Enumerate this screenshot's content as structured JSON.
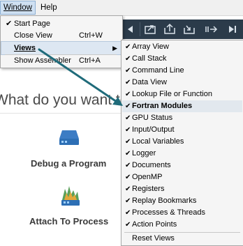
{
  "menubar": {
    "window_label": "Window",
    "help_label": "Help"
  },
  "window_menu": {
    "items": [
      {
        "label": "Start Page",
        "checked": true,
        "shortcut": ""
      },
      {
        "label": "Close View",
        "checked": false,
        "shortcut": "Ctrl+W"
      },
      {
        "label": "Views",
        "checked": false,
        "shortcut": "",
        "submenu": true
      },
      {
        "label": "Show Assembler",
        "checked": false,
        "shortcut": "Ctrl+A"
      }
    ]
  },
  "views_menu": {
    "items": [
      {
        "label": "Array View",
        "checked": true
      },
      {
        "label": "Call Stack",
        "checked": true
      },
      {
        "label": "Command Line",
        "checked": true
      },
      {
        "label": "Data View",
        "checked": true
      },
      {
        "label": "Lookup File or Function",
        "checked": true
      },
      {
        "label": "Fortran Modules",
        "checked": true
      },
      {
        "label": "GPU Status",
        "checked": true
      },
      {
        "label": "Input/Output",
        "checked": true
      },
      {
        "label": "Local Variables",
        "checked": true
      },
      {
        "label": "Logger",
        "checked": true
      },
      {
        "label": "Documents",
        "checked": true
      },
      {
        "label": "OpenMP",
        "checked": true
      },
      {
        "label": "Registers",
        "checked": true
      },
      {
        "label": "Replay Bookmarks",
        "checked": true
      },
      {
        "label": "Processes & Threads",
        "checked": true
      },
      {
        "label": "Action Points",
        "checked": true
      }
    ],
    "reset_label": "Reset Views"
  },
  "start_page": {
    "heading": "What do you want to",
    "actions": [
      {
        "label": "Debug a Program",
        "icon": "server-drive-icon"
      },
      {
        "label": "Attach To Process",
        "icon": "attach-process-icon"
      }
    ]
  },
  "toolbar": {
    "icons": [
      "back-arrow-icon",
      "step-out-icon",
      "step-in-icon",
      "return-icon",
      "jump-icon",
      "skip-end-icon"
    ]
  },
  "colors": {
    "toolbar_bg": "#2b3b4a",
    "annotation_arrow": "#1f6b7a",
    "menu_highlight": "#dde7f2",
    "icon_blue": "#2d6fb5"
  }
}
